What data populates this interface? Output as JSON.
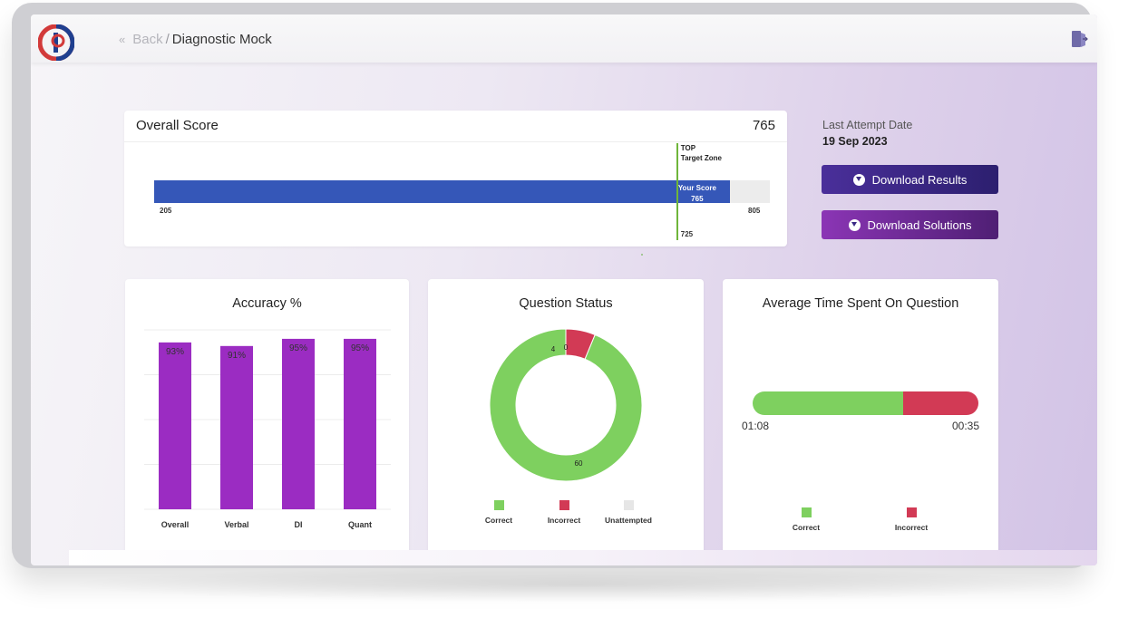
{
  "header": {
    "back_label": "Back",
    "separator": "/",
    "page_title": "Diagnostic Mock"
  },
  "overall_score": {
    "title": "Overall Score",
    "score": "765",
    "your_score_label": "Your Score",
    "your_score_value": "765",
    "min": "205",
    "max": "805",
    "target_label_line1": "TOP",
    "target_label_line2": "Target Zone",
    "target_value": "725",
    "score_num": 765,
    "min_num": 205,
    "max_num": 805,
    "target_num": 725
  },
  "attempt": {
    "label": "Last Attempt Date",
    "date": "19 Sep 2023"
  },
  "buttons": {
    "download_results": "Download Results",
    "download_solutions": "Download Solutions"
  },
  "accuracy": {
    "title": "Accuracy %"
  },
  "question_status": {
    "title": "Question Status",
    "legend": [
      "Correct",
      "Incorrect",
      "Unattempted"
    ],
    "labels": [
      "60",
      "4",
      "0"
    ]
  },
  "avg_time": {
    "title": "Average Time Spent On Question",
    "correct_time": "01:08",
    "incorrect_time": "00:35",
    "legend": [
      "Correct",
      "Incorrect"
    ]
  },
  "colors": {
    "accent_blue": "#3557b8",
    "purple": "#9b2cc2",
    "green": "#7ed05f",
    "red": "#d23a55",
    "grey": "#e6e6e6"
  },
  "chart_data": [
    {
      "type": "bar",
      "title": "Accuracy %",
      "categories": [
        "Overall",
        "Verbal",
        "DI",
        "Quant"
      ],
      "values": [
        93,
        91,
        95,
        95
      ],
      "value_labels": [
        "93%",
        "91%",
        "95%",
        "95%"
      ],
      "ylim": [
        0,
        100
      ],
      "grid": true
    },
    {
      "type": "pie",
      "title": "Question Status",
      "categories": [
        "Correct",
        "Incorrect",
        "Unattempted"
      ],
      "values": [
        60,
        4,
        0
      ],
      "donut": true
    },
    {
      "type": "bar",
      "title": "Average Time Spent On Question",
      "categories": [
        "Correct",
        "Incorrect"
      ],
      "values": [
        68,
        35
      ],
      "value_labels": [
        "01:08",
        "00:35"
      ],
      "orientation": "horizontal-stacked"
    }
  ]
}
